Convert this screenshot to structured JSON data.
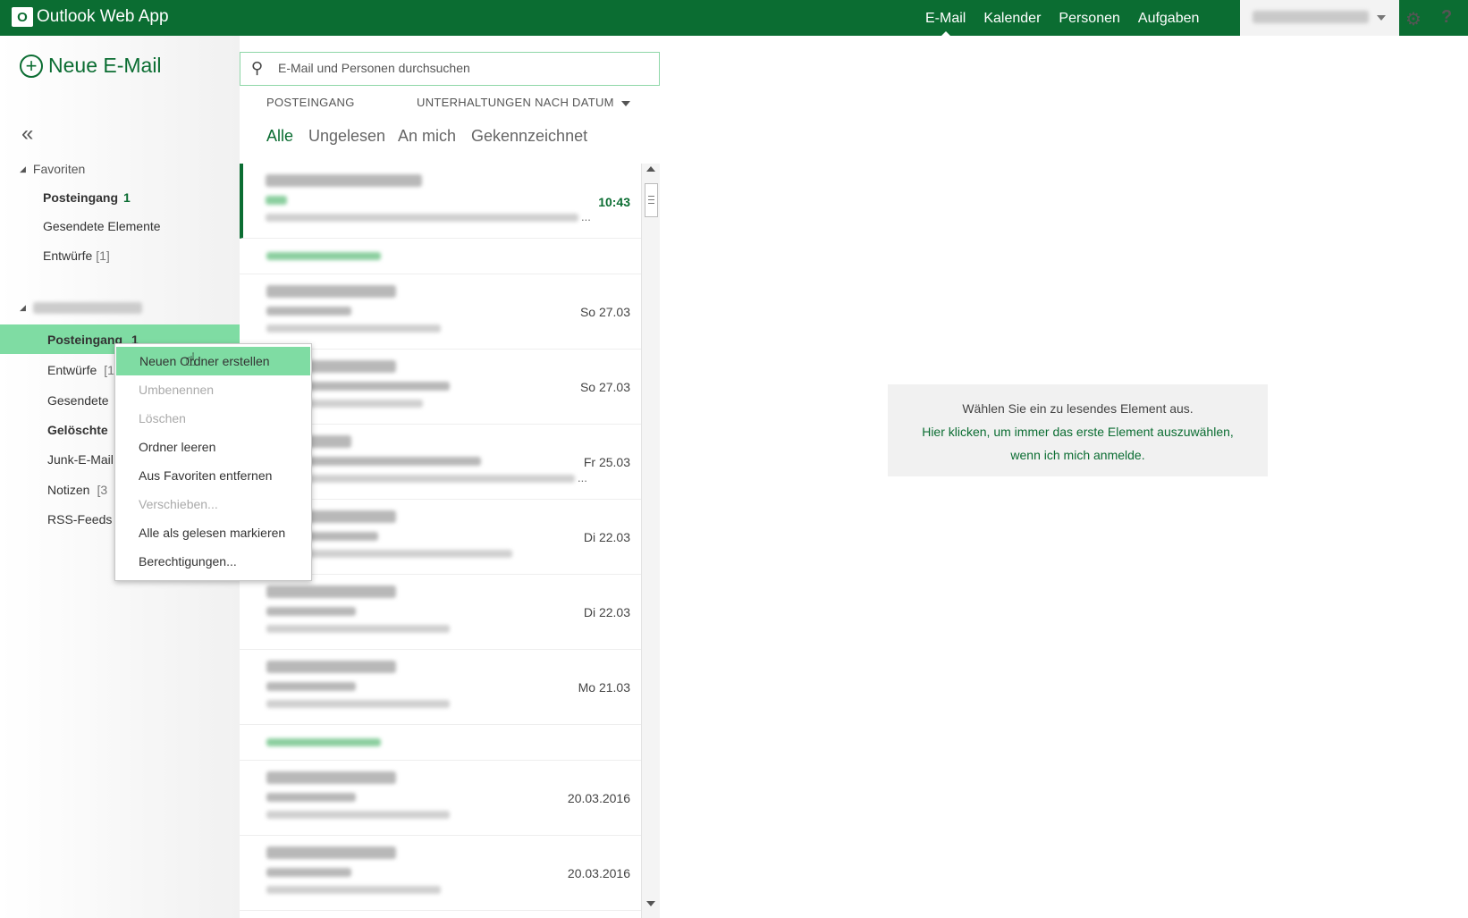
{
  "app": {
    "title": "Outlook Web App",
    "logo_glyph": "O"
  },
  "top_nav": {
    "items": [
      {
        "label": "E-Mail",
        "active": true
      },
      {
        "label": "Kalender",
        "active": false
      },
      {
        "label": "Personen",
        "active": false
      },
      {
        "label": "Aufgaben",
        "active": false
      }
    ],
    "settings_icon": "gear-icon",
    "help_icon": "help-icon",
    "help_glyph": "?",
    "settings_glyph": "⚙"
  },
  "left": {
    "new_mail_label": "Neue E-Mail",
    "new_mail_glyph": "+",
    "collapse_glyph": "«",
    "favorites_label": "Favoriten",
    "favorites": [
      {
        "label": "Posteingang",
        "count": "1"
      },
      {
        "label": "Gesendete Elemente",
        "count": ""
      },
      {
        "label": "Entwürfe",
        "count": "[1]"
      }
    ],
    "account_folders": [
      {
        "label": "Posteingang",
        "count": "1"
      },
      {
        "label": "Entwürfe",
        "count": "[1"
      },
      {
        "label": "Gesendete",
        "count": ""
      },
      {
        "label": "Gelöschte",
        "count": ""
      },
      {
        "label": "Junk-E-Mail",
        "count": ""
      },
      {
        "label": "Notizen",
        "count": "[3"
      },
      {
        "label": "RSS-Feeds",
        "count": ""
      }
    ]
  },
  "search": {
    "placeholder": "E-Mail und Personen durchsuchen",
    "icon_glyph": "⚲"
  },
  "list_header": {
    "folder_label": "POSTEINGANG",
    "sort_label": "UNTERHALTUNGEN NACH DATUM"
  },
  "filters": [
    "Alle",
    "Ungelesen",
    "An mich",
    "Gekennzeichnet"
  ],
  "messages": [
    {
      "date": "10:43",
      "ellipsis": "..."
    },
    {
      "date": "So 27.03"
    },
    {
      "date": "So 27.03"
    },
    {
      "date": "Fr 25.03",
      "ellipsis": "..."
    },
    {
      "date": "Di 22.03"
    },
    {
      "date": "Di 22.03"
    },
    {
      "date": "Mo 21.03"
    },
    {
      "date": "20.03.2016"
    },
    {
      "date": "20.03.2016"
    }
  ],
  "reading_pane": {
    "hint": "Wählen Sie ein zu lesendes Element aus.",
    "link_line1": "Hier klicken, um immer das erste Element auszuwählen,",
    "link_line2": "wenn ich mich anmelde."
  },
  "context_menu": {
    "items": [
      {
        "label": "Neuen Ordner erstellen",
        "state": "highlighted"
      },
      {
        "label": "Umbenennen",
        "state": "disabled"
      },
      {
        "label": "Löschen",
        "state": "disabled"
      },
      {
        "label": "Ordner leeren",
        "state": "enabled"
      },
      {
        "label": "Aus Favoriten entfernen",
        "state": "enabled"
      },
      {
        "label": "Verschieben...",
        "state": "disabled"
      },
      {
        "label": "Alle als gelesen markieren",
        "state": "enabled"
      },
      {
        "label": "Berechtigungen...",
        "state": "enabled"
      }
    ]
  },
  "colors": {
    "brand": "#0b6d32",
    "selection": "#7fdca3"
  }
}
